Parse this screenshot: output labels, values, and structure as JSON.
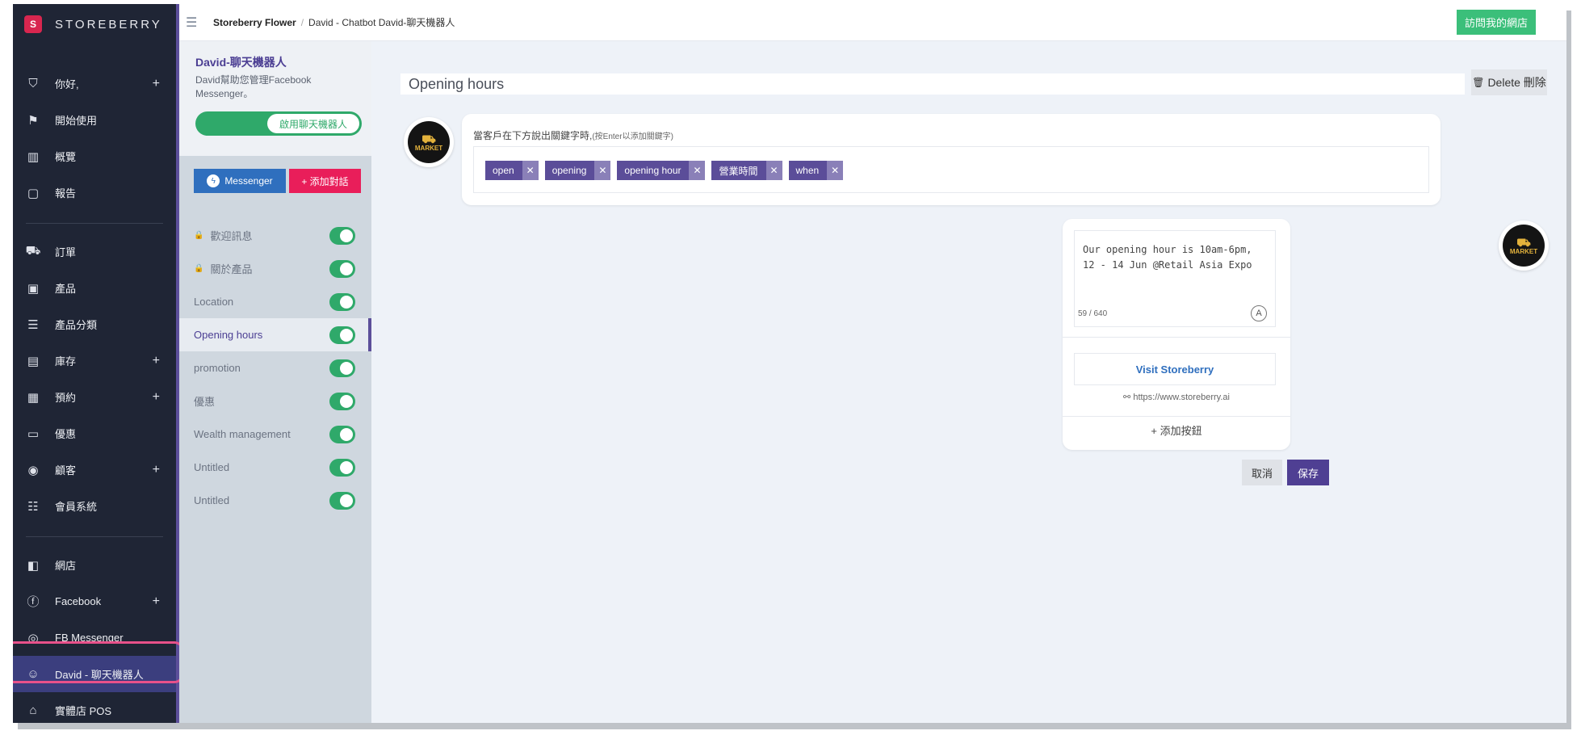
{
  "brand": {
    "name": "STOREBERRY",
    "logo_glyph": "S"
  },
  "nav": {
    "items_top": [
      {
        "icon": "user-icon",
        "glyph": "⛉",
        "label": "你好,",
        "plus": true
      },
      {
        "icon": "flag-icon",
        "glyph": "⚑",
        "label": "開始使用",
        "plus": false
      },
      {
        "icon": "chart-icon",
        "glyph": "▥",
        "label": "概覽",
        "plus": false
      },
      {
        "icon": "report-icon",
        "glyph": "▢",
        "label": "報告",
        "plus": false
      }
    ],
    "items_mid": [
      {
        "icon": "cart-icon",
        "glyph": "⛟",
        "label": "訂單",
        "plus": false
      },
      {
        "icon": "bag-icon",
        "glyph": "▣",
        "label": "產品",
        "plus": false
      },
      {
        "icon": "list-icon",
        "glyph": "☰",
        "label": "產品分類",
        "plus": false
      },
      {
        "icon": "inventory-icon",
        "glyph": "▤",
        "label": "庫存",
        "plus": true
      },
      {
        "icon": "calendar-icon",
        "glyph": "▦",
        "label": "預約",
        "plus": true
      },
      {
        "icon": "coupon-icon",
        "glyph": "▭",
        "label": "優惠",
        "plus": false
      },
      {
        "icon": "customer-icon",
        "glyph": "◉",
        "label": "顧客",
        "plus": true
      },
      {
        "icon": "member-icon",
        "glyph": "☷",
        "label": "會員系統",
        "plus": false
      }
    ],
    "items_bottom": [
      {
        "icon": "store-icon",
        "glyph": "◧",
        "label": "網店",
        "plus": false
      },
      {
        "icon": "facebook-icon",
        "glyph": "ⓕ",
        "label": "Facebook",
        "plus": true
      },
      {
        "icon": "messenger-icon",
        "glyph": "◎",
        "label": "FB Messenger",
        "plus": false
      },
      {
        "icon": "robot-icon",
        "glyph": "☺",
        "label": "David - 聊天機器人",
        "plus": false,
        "active": true
      },
      {
        "icon": "pos-icon",
        "glyph": "⌂",
        "label": "實體店 POS",
        "plus": false
      }
    ]
  },
  "topbar": {
    "crumb_store": "Storeberry Flower",
    "crumb_sep": "/",
    "crumb_page": "David - Chatbot David-聊天機器人",
    "visit_label": "訪問我的網店"
  },
  "mid": {
    "title": "David-聊天機器人",
    "desc": "David幫助您管理Facebook Messenger。",
    "enable_label": "啟用聊天機器人",
    "messenger_label": "Messenger",
    "add_conv_label": "+ 添加對話",
    "conversations": [
      {
        "label": "歡迎訊息",
        "locked": true,
        "on": true,
        "active": false
      },
      {
        "label": "關於產品",
        "locked": true,
        "on": true,
        "active": false
      },
      {
        "label": "Location",
        "locked": false,
        "on": true,
        "active": false
      },
      {
        "label": "Opening hours",
        "locked": false,
        "on": true,
        "active": true
      },
      {
        "label": "promotion",
        "locked": false,
        "on": true,
        "active": false
      },
      {
        "label": "優惠",
        "locked": false,
        "on": true,
        "active": false
      },
      {
        "label": "Wealth management",
        "locked": false,
        "on": true,
        "active": false
      },
      {
        "label": "Untitled",
        "locked": false,
        "on": true,
        "active": false
      },
      {
        "label": "Untitled",
        "locked": false,
        "on": true,
        "active": false
      }
    ]
  },
  "editor": {
    "title": "Opening hours",
    "delete_label": "Delete 刪除",
    "avatar_text": "MARKET",
    "keyword_hint": "當客戶在下方說出關鍵字時,",
    "keyword_hint_small": "(按Enter以添加關鍵字)",
    "tags": [
      "open",
      "opening",
      "opening hour",
      "營業時間",
      "when"
    ],
    "reply_text": "Our opening hour is 10am-6pm, 12 - 14 Jun @Retail Asia Expo",
    "reply_count": "59 / 640",
    "reply_a": "A",
    "button_label": "Visit Storeberry",
    "button_link": "https://www.storeberry.ai",
    "add_button_label": "+ 添加按鈕",
    "cancel_label": "取消",
    "save_label": "保存"
  },
  "colors": {
    "nav_bg": "#1f2535",
    "accent": "#5b4d99",
    "green": "#2fa96a",
    "pink": "#e91e5a",
    "blue": "#2f6fbe",
    "highlight": "#e8518a"
  }
}
